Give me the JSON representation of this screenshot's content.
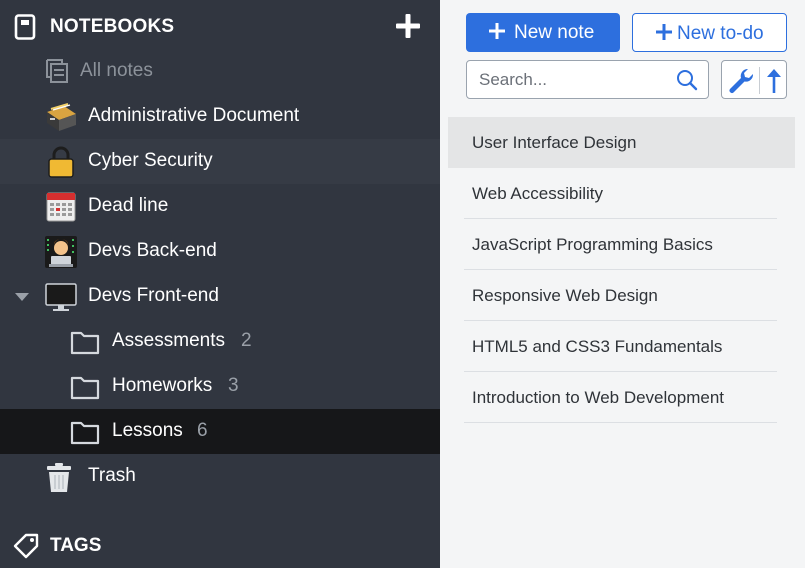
{
  "sidebar": {
    "notebooks_header": "NOTEBOOKS",
    "tags_header": "TAGS",
    "items": [
      {
        "label": "All notes",
        "count": "",
        "icon": "all-notes-icon",
        "state": "dim"
      },
      {
        "label": "Administrative Document",
        "count": "",
        "icon": "cabinet-icon",
        "state": ""
      },
      {
        "label": "Cyber Security",
        "count": "",
        "icon": "lock-icon",
        "state": "hover"
      },
      {
        "label": "Dead line",
        "count": "",
        "icon": "calendar-icon",
        "state": ""
      },
      {
        "label": "Devs Back-end",
        "count": "",
        "icon": "technologist-icon",
        "state": ""
      },
      {
        "label": "Devs Front-end",
        "count": "",
        "icon": "monitor-icon",
        "state": "expanded"
      },
      {
        "label": "Assessments",
        "count": "2",
        "icon": "folder-icon",
        "state": ""
      },
      {
        "label": "Homeworks",
        "count": "3",
        "icon": "folder-icon",
        "state": ""
      },
      {
        "label": "Lessons",
        "count": "6",
        "icon": "folder-icon",
        "state": "selected"
      },
      {
        "label": "Trash",
        "count": "",
        "icon": "trash-icon",
        "state": ""
      }
    ]
  },
  "toolbar": {
    "new_note_label": "New note",
    "new_todo_label": "New to-do",
    "search_placeholder": "Search..."
  },
  "notes": [
    {
      "title": "User Interface Design",
      "selected": true
    },
    {
      "title": "Web Accessibility",
      "selected": false
    },
    {
      "title": "JavaScript Programming Basics",
      "selected": false
    },
    {
      "title": "Responsive Web Design",
      "selected": false
    },
    {
      "title": "HTML5 and CSS3 Fundamentals",
      "selected": false
    },
    {
      "title": "Introduction to Web Development",
      "selected": false
    }
  ],
  "colors": {
    "sidebar_bg": "#313640",
    "sidebar_selected": "#161719",
    "accent": "#2d6fde",
    "notes_bg": "#f4f5f6"
  }
}
